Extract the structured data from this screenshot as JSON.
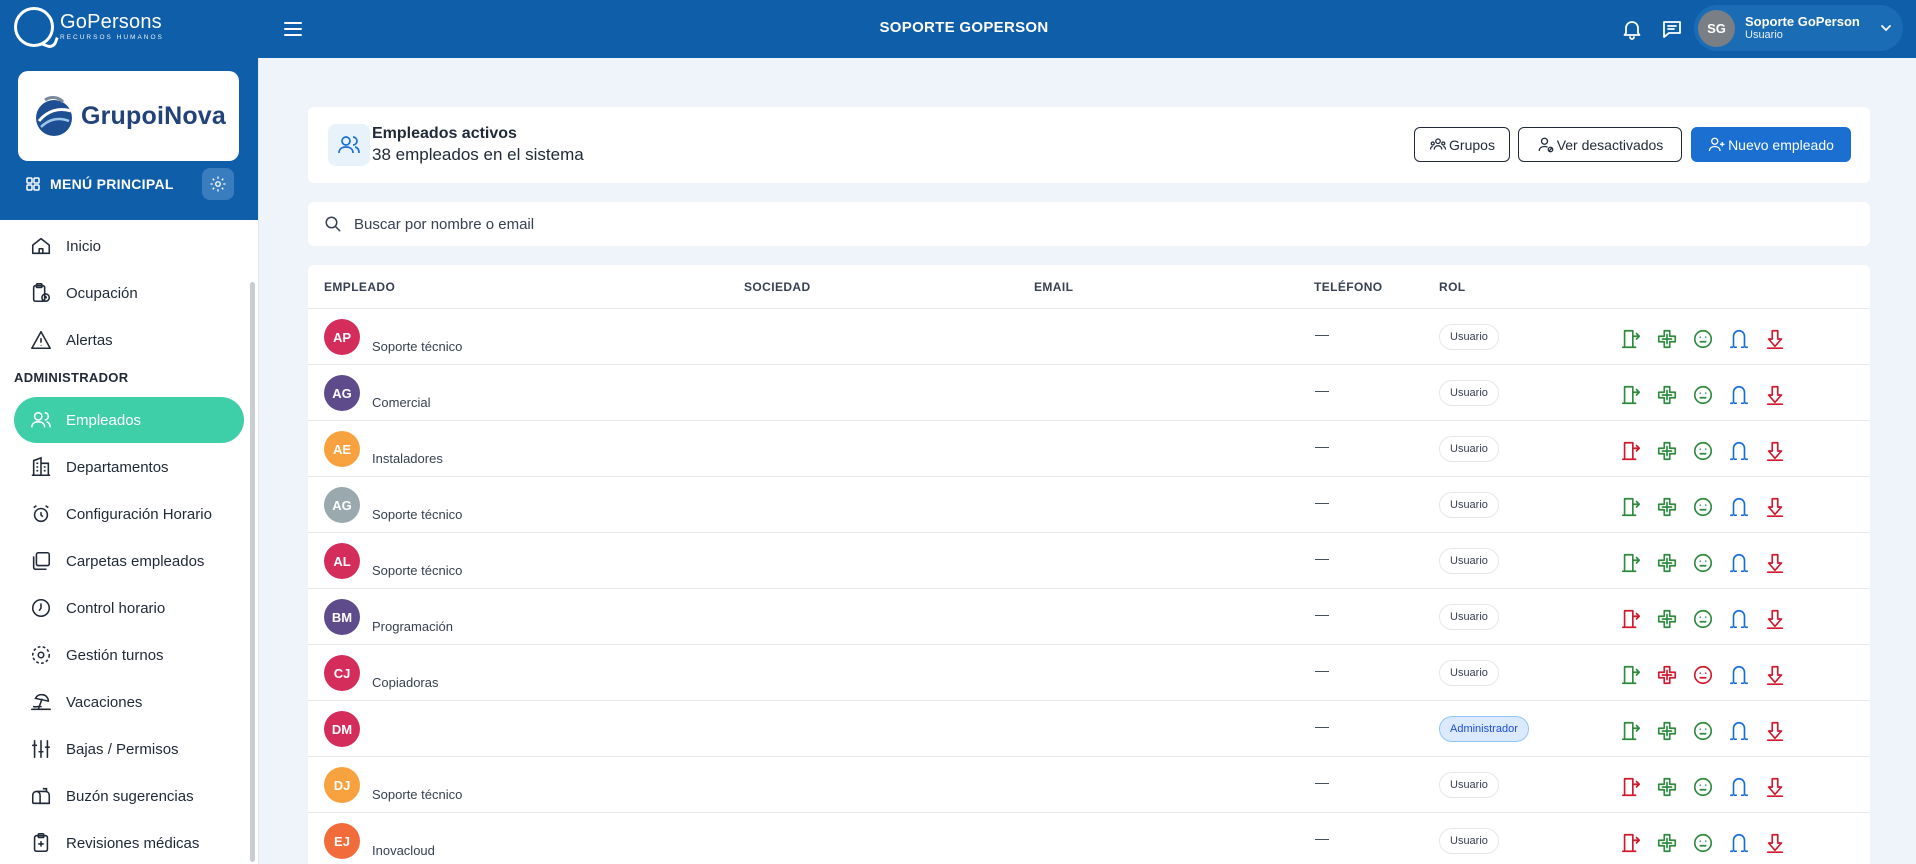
{
  "topbar": {
    "logo_main": "GoPersons",
    "logo_sub": "RECURSOS HUMANOS",
    "title": "SOPORTE GOPERSON",
    "user": {
      "initials": "SG",
      "name": "Soporte GoPerson",
      "role": "Usuario"
    }
  },
  "sidebar": {
    "brand": "GrupoiNova",
    "menu_title": "MENÚ PRINCIPAL",
    "section_admin": "ADMINISTRADOR",
    "items": [
      {
        "label": "Inicio",
        "icon": "home-icon"
      },
      {
        "label": "Ocupación",
        "icon": "clipboard-clock-icon"
      },
      {
        "label": "Alertas",
        "icon": "alert-triangle-icon"
      },
      {
        "label": "Empleados",
        "icon": "users-icon",
        "active": true
      },
      {
        "label": "Departamentos",
        "icon": "building-icon"
      },
      {
        "label": "Configuración Horario",
        "icon": "alarm-clock-icon"
      },
      {
        "label": "Carpetas empleados",
        "icon": "folders-icon"
      },
      {
        "label": "Control horario",
        "icon": "clock-icon"
      },
      {
        "label": "Gestión turnos",
        "icon": "shift-rotate-icon"
      },
      {
        "label": "Vacaciones",
        "icon": "beach-icon"
      },
      {
        "label": "Bajas / Permisos",
        "icon": "sliders-icon"
      },
      {
        "label": "Buzón sugerencias",
        "icon": "mailbox-icon"
      },
      {
        "label": "Revisiones médicas",
        "icon": "medical-clipboard-icon"
      }
    ]
  },
  "header": {
    "title": "Empleados activos",
    "subtitle": "38 empleados en el sistema",
    "btn_groups": "Grupos",
    "btn_deactivated": "Ver desactivados",
    "btn_new": "Nuevo empleado"
  },
  "search": {
    "placeholder": "Buscar por nombre o email"
  },
  "table": {
    "columns": [
      "EMPLEADO",
      "SOCIEDAD",
      "EMAIL",
      "TELÉFONO",
      "ROL"
    ],
    "rows": [
      {
        "initials": "AP",
        "color": "#d52d5b",
        "dept": "Soporte técnico",
        "phone": "—",
        "role": "Usuario",
        "exit_alert": false,
        "health_alert": false
      },
      {
        "initials": "AG",
        "color": "#5e4b8b",
        "dept": "Comercial",
        "phone": "—",
        "role": "Usuario",
        "exit_alert": false,
        "health_alert": false
      },
      {
        "initials": "AE",
        "color": "#f7a13f",
        "dept": "Instaladores",
        "phone": "—",
        "role": "Usuario",
        "exit_alert": true,
        "health_alert": false
      },
      {
        "initials": "AG",
        "color": "#9aa9ae",
        "dept": "Soporte técnico",
        "phone": "—",
        "role": "Usuario",
        "exit_alert": false,
        "health_alert": false
      },
      {
        "initials": "AL",
        "color": "#d52d5b",
        "dept": "Soporte técnico",
        "phone": "—",
        "role": "Usuario",
        "exit_alert": false,
        "health_alert": false
      },
      {
        "initials": "BM",
        "color": "#5e4b8b",
        "dept": "Programación",
        "phone": "—",
        "role": "Usuario",
        "exit_alert": true,
        "health_alert": false
      },
      {
        "initials": "CJ",
        "color": "#d52d5b",
        "dept": "Copiadoras",
        "phone": "—",
        "role": "Usuario",
        "exit_alert": false,
        "health_alert": true
      },
      {
        "initials": "DM",
        "color": "#d52d5b",
        "dept": "",
        "phone": "—",
        "role": "Administrador",
        "exit_alert": false,
        "health_alert": false
      },
      {
        "initials": "DJ",
        "color": "#f7a13f",
        "dept": "Soporte técnico",
        "phone": "—",
        "role": "Usuario",
        "exit_alert": true,
        "health_alert": false
      },
      {
        "initials": "EJ",
        "color": "#f26b3a",
        "dept": "Inovacloud",
        "phone": "—",
        "role": "Usuario",
        "exit_alert": true,
        "health_alert": false
      }
    ]
  },
  "colors": {
    "primary": "#0e5ea9",
    "accent": "#3fcfa8",
    "ok": "#2e8b3e",
    "alert": "#d0192f",
    "info": "#1a6fd1"
  }
}
